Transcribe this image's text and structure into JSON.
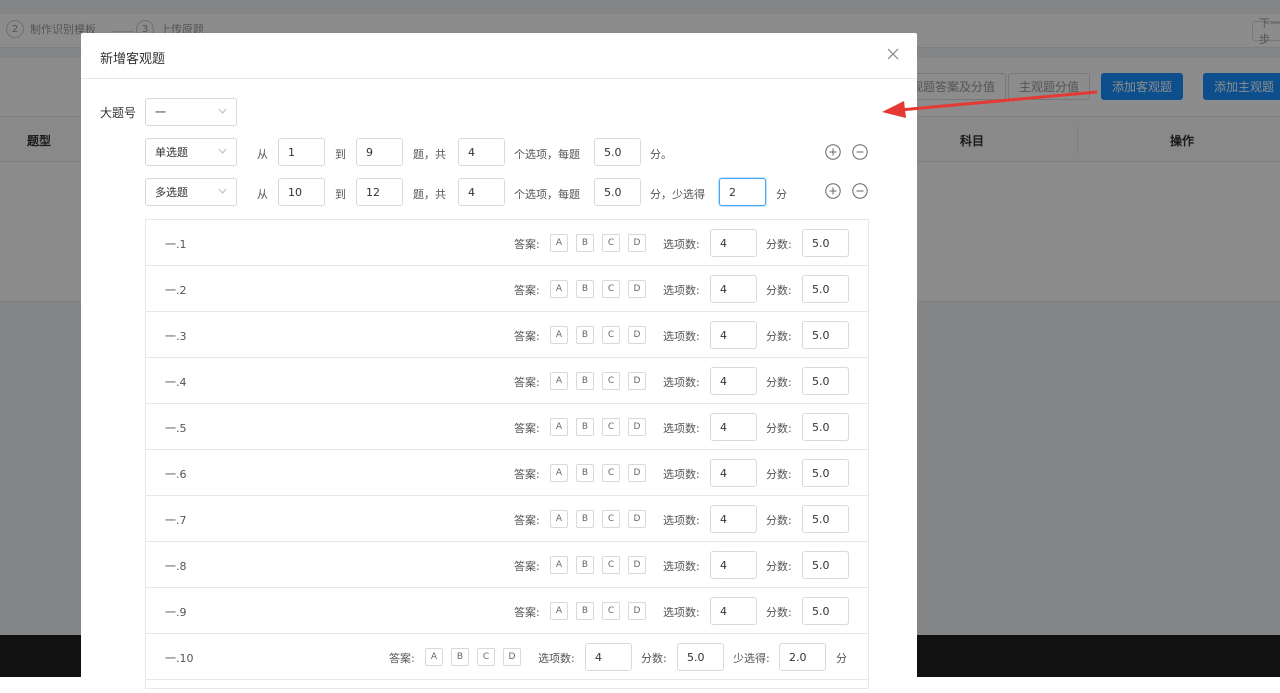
{
  "background": {
    "steps": [
      {
        "num": "2",
        "label": "制作识别模板"
      },
      {
        "num": "3",
        "label": "上传原题"
      }
    ],
    "next_label": "下一步",
    "toolbar_buttons": [
      {
        "label": "客观题答案及分值",
        "style": "plain"
      },
      {
        "label": "主观题分值",
        "style": "plain"
      },
      {
        "label": "添加客观题",
        "style": "primary"
      },
      {
        "label": "添加主观题",
        "style": "primary"
      }
    ],
    "table_headers": [
      "题型",
      "科目",
      "操作"
    ]
  },
  "modal": {
    "title": "新增客观题",
    "big_question_label": "大题号",
    "big_question_value": "一",
    "rule_rows": [
      {
        "type": "单选题",
        "from_label": "从",
        "from": "1",
        "to_label": "到",
        "to": "9",
        "total_label": "题，共",
        "options": "4",
        "options_label": "个选项，每题",
        "score": "5.0",
        "score_suffix": "分。",
        "partial_label": "",
        "partial": "",
        "partial_suffix": ""
      },
      {
        "type": "多选题",
        "from_label": "从",
        "from": "10",
        "to_label": "到",
        "to": "12",
        "total_label": "题，共",
        "options": "4",
        "options_label": "个选项，每题",
        "score": "5.0",
        "score_suffix": "分，少选得",
        "partial_label": "",
        "partial": "2",
        "partial_suffix": "分"
      }
    ],
    "labels": {
      "answer": "答案:",
      "option_count": "选项数:",
      "score": "分数:",
      "partial": "少选得:",
      "unit": "分"
    },
    "questions": [
      {
        "no": "一.1",
        "options": [
          "A",
          "B",
          "C",
          "D"
        ],
        "option_count": "4",
        "score": "5.0"
      },
      {
        "no": "一.2",
        "options": [
          "A",
          "B",
          "C",
          "D"
        ],
        "option_count": "4",
        "score": "5.0"
      },
      {
        "no": "一.3",
        "options": [
          "A",
          "B",
          "C",
          "D"
        ],
        "option_count": "4",
        "score": "5.0"
      },
      {
        "no": "一.4",
        "options": [
          "A",
          "B",
          "C",
          "D"
        ],
        "option_count": "4",
        "score": "5.0"
      },
      {
        "no": "一.5",
        "options": [
          "A",
          "B",
          "C",
          "D"
        ],
        "option_count": "4",
        "score": "5.0"
      },
      {
        "no": "一.6",
        "options": [
          "A",
          "B",
          "C",
          "D"
        ],
        "option_count": "4",
        "score": "5.0"
      },
      {
        "no": "一.7",
        "options": [
          "A",
          "B",
          "C",
          "D"
        ],
        "option_count": "4",
        "score": "5.0"
      },
      {
        "no": "一.8",
        "options": [
          "A",
          "B",
          "C",
          "D"
        ],
        "option_count": "4",
        "score": "5.0"
      },
      {
        "no": "一.9",
        "options": [
          "A",
          "B",
          "C",
          "D"
        ],
        "option_count": "4",
        "score": "5.0"
      },
      {
        "no": "一.10",
        "options": [
          "A",
          "B",
          "C",
          "D"
        ],
        "option_count": "4",
        "score": "5.0",
        "partial": "2.0"
      }
    ]
  },
  "colors": {
    "primary": "#1890ff",
    "annotation_arrow": "#e53935",
    "mask": "rgba(0,0,0,0.45)"
  }
}
